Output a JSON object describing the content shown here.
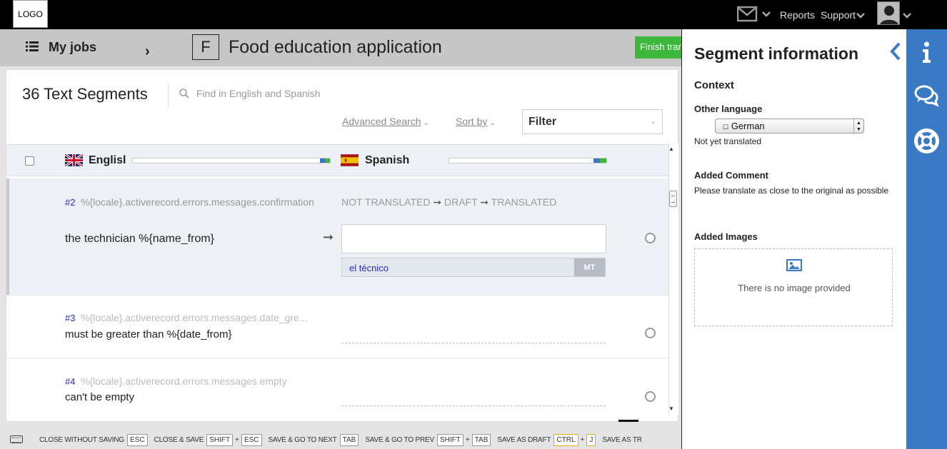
{
  "topbar": {
    "logo": "LOGO",
    "reports": "Reports",
    "support": "Support"
  },
  "header": {
    "my_jobs": "My jobs",
    "project_initial": "F",
    "project_title": "Food education application",
    "finish_button": "Finish translation"
  },
  "segments_panel": {
    "count_label": "36 Text Segments",
    "search_placeholder": "Find in English and Spanish",
    "advanced_search": "Advanced Search",
    "sort_by": "Sort by",
    "filter": "Filter",
    "source_language": "Englisl",
    "target_language": "Spanish",
    "status_flow": [
      "NOT TRANSLATED",
      "DRAFT",
      "TRANSLATED"
    ],
    "rows": [
      {
        "number": "#2",
        "key": "%{locale}.activerecord.errors.messages.confirmation",
        "source": "the technician %{name_from}",
        "mt_suggestion": "el técnico",
        "mt_badge": "MT"
      },
      {
        "number": "#3",
        "key": "%{locale}.activerecord.errors.messages.date_gre...",
        "source": "must be greater than %{date_from}"
      },
      {
        "number": "#4",
        "key": "%{locale}.activerecord.errors.messages.empty",
        "source": "can't be empty"
      }
    ]
  },
  "shortcuts": [
    {
      "label": "Close without saving",
      "keys": [
        "ESC"
      ]
    },
    {
      "label": "Close & save",
      "keys": [
        "SHIFT",
        "ESC"
      ]
    },
    {
      "label": "Save & go to next",
      "keys": [
        "TAB"
      ]
    },
    {
      "label": "Save & go to prev",
      "keys": [
        "SHIFT",
        "TAB"
      ]
    },
    {
      "label": "Save as draft",
      "keys": [
        "CTRL",
        "J"
      ]
    },
    {
      "label": "Save as tr",
      "keys": []
    }
  ],
  "info_panel": {
    "title": "Segment information",
    "context_heading": "Context",
    "other_language_heading": "Other language",
    "other_language_value": "German",
    "other_language_status": "Not yet translated",
    "comment_heading": "Added Comment",
    "comment_text": "Please translate as close to the original as possible",
    "images_heading": "Added Images",
    "images_empty": "There is no image provided"
  },
  "colors": {
    "accent_blue": "#3a7ac4",
    "finish_green": "#3db83d",
    "link_blue": "#2a2ac8"
  },
  "icons": {
    "mail": "mail-icon",
    "avatar": "user-avatar-icon",
    "list": "list-icon",
    "search": "search-icon",
    "uk_flag": "uk-flag-icon",
    "spain_flag": "spain-flag-icon",
    "info": "info-icon",
    "chat": "chat-icon",
    "help": "lifebuoy-icon",
    "keyboard": "keyboard-icon",
    "image": "image-icon"
  }
}
